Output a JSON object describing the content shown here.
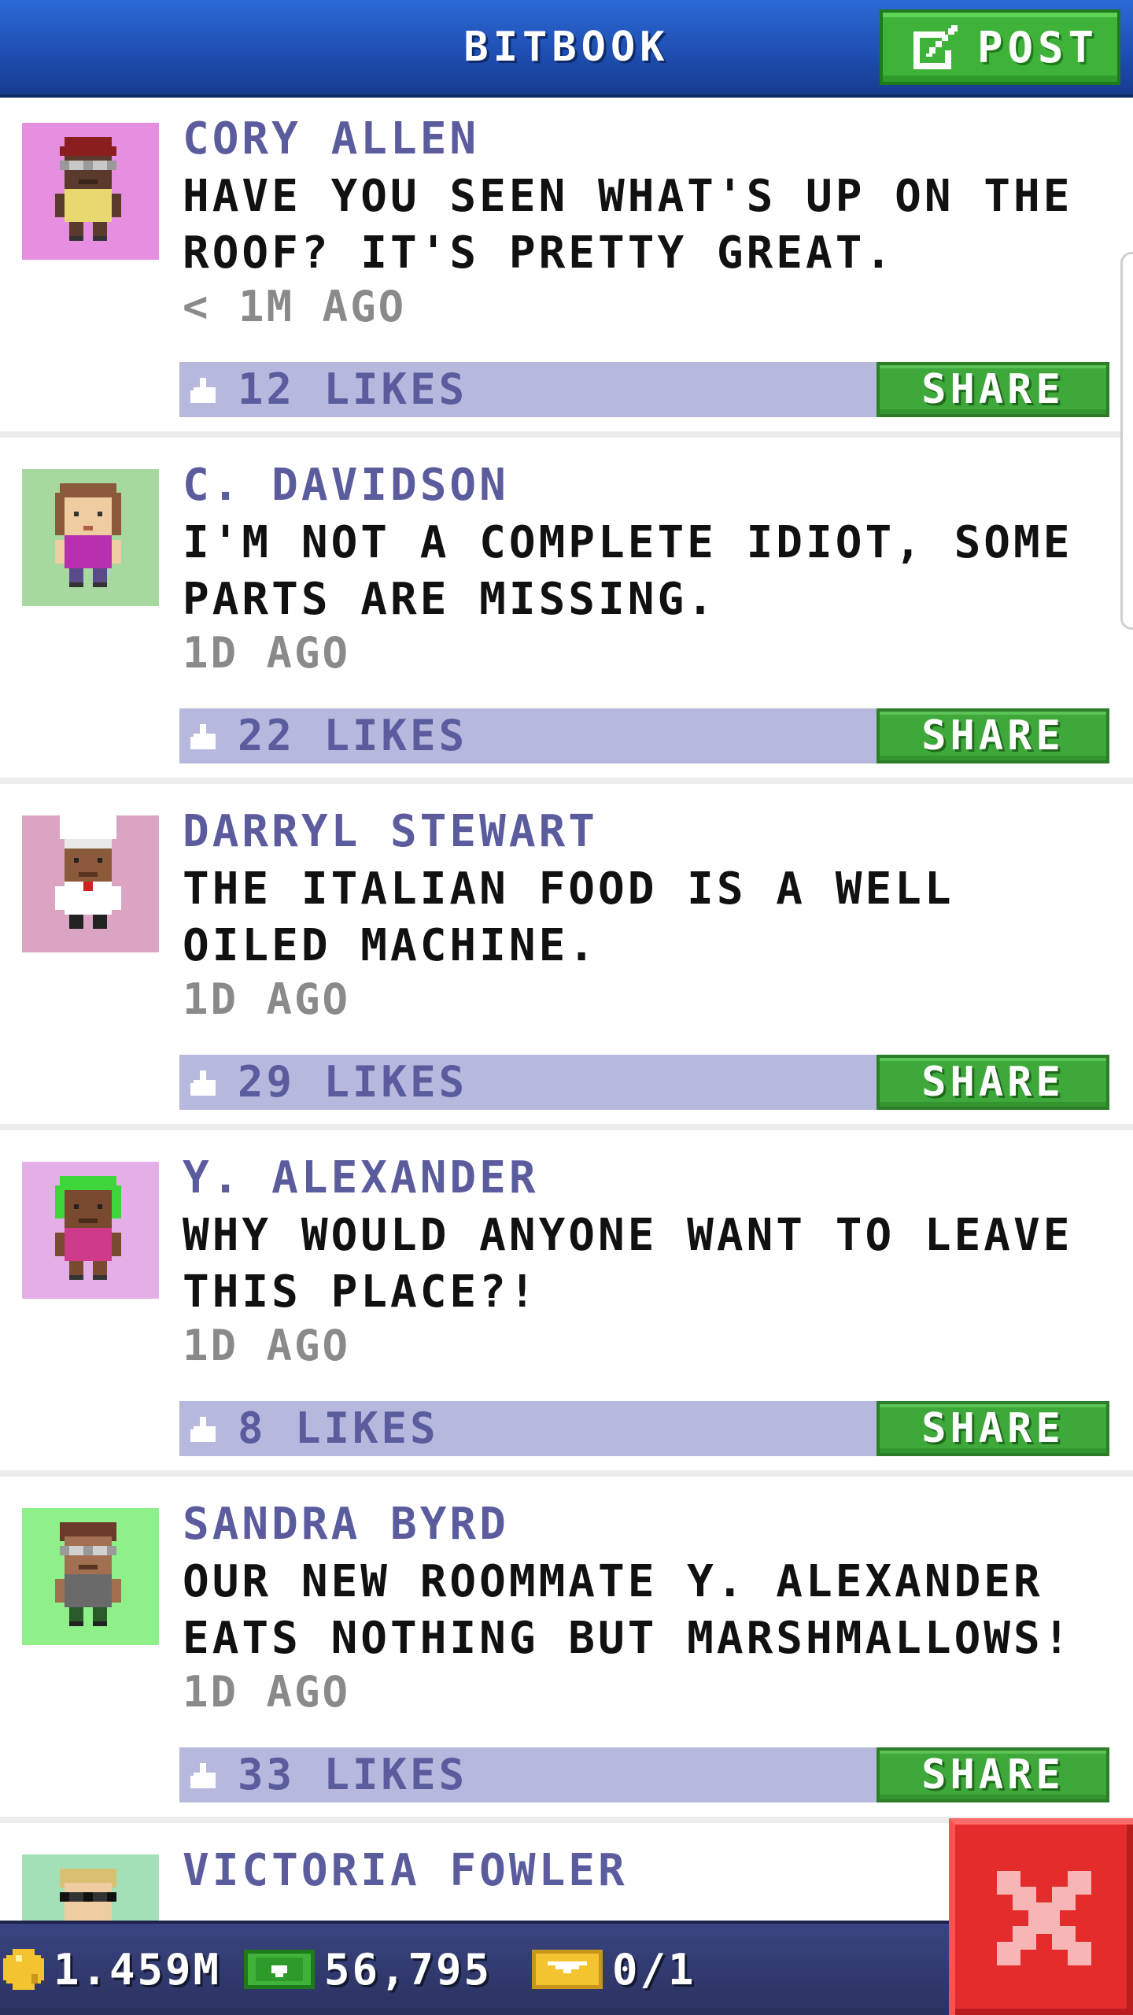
{
  "header": {
    "title": "BITBOOK",
    "post_label": "POST"
  },
  "feed": {
    "posts": [
      {
        "author": "CORY ALLEN",
        "text": "HAVE YOU SEEN WHAT'S UP ON THE ROOF? IT'S PRETTY GREAT.",
        "time": "< 1M AGO",
        "likes": "12 LIKES",
        "share_label": "SHARE",
        "avatar_bg": "#e68fe0"
      },
      {
        "author": "C. DAVIDSON",
        "text": "I'M NOT A COMPLETE IDIOT, SOME PARTS ARE MISSING.",
        "time": "1D AGO",
        "likes": "22 LIKES",
        "share_label": "SHARE",
        "avatar_bg": "#a6d8a0"
      },
      {
        "author": "DARRYL STEWART",
        "text": "THE ITALIAN FOOD IS A WELL OILED MACHINE.",
        "time": "1D AGO",
        "likes": "29 LIKES",
        "share_label": "SHARE",
        "avatar_bg": "#dba4c3"
      },
      {
        "author": "Y. ALEXANDER",
        "text": "WHY WOULD ANYONE WANT TO LEAVE THIS PLACE?!",
        "time": "1D AGO",
        "likes": "8 LIKES",
        "share_label": "SHARE",
        "avatar_bg": "#e4aee6"
      },
      {
        "author": "SANDRA BYRD",
        "text": "OUR NEW ROOMMATE Y. ALEXANDER EATS NOTHING BUT MARSHMALLOWS!",
        "time": "1D AGO",
        "likes": "33 LIKES",
        "share_label": "SHARE",
        "avatar_bg": "#8ff08a"
      },
      {
        "author": "VICTORIA FOWLER",
        "avatar_bg": "#a3e0b8"
      }
    ]
  },
  "bottom_bar": {
    "coins": "1.459M",
    "bux": "56,795",
    "tickets": "0/1"
  },
  "colors": {
    "accent_blue": "#1f4fb2",
    "share_green": "#3fa83a",
    "likes_bar": "#b6b8de",
    "name_purple": "#5b5c9e",
    "close_red": "#e52c2c"
  },
  "icons": {
    "post": "edit-icon",
    "like": "thumbs-up-icon",
    "coin": "coin-icon",
    "bux": "bux-icon",
    "ticket": "ticket-icon",
    "close": "close-icon"
  }
}
